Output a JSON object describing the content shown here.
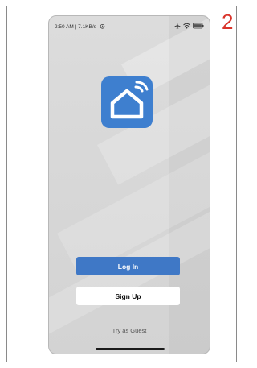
{
  "figure": {
    "step_number": "2"
  },
  "status_bar": {
    "time_speed": "2:50 AM | 7.1KB/s",
    "icons": [
      "alarm-icon",
      "airplane-icon",
      "wifi-icon",
      "battery-icon"
    ]
  },
  "app": {
    "icon": "smart-home-icon",
    "brand_color": "#3e7fcf"
  },
  "buttons": {
    "login_label": "Log In",
    "signup_label": "Sign Up"
  },
  "guest": {
    "label": "Try as Guest"
  },
  "colors": {
    "step_number": "#d9342b",
    "login_button": "#3f78c6",
    "signup_button": "#ffffff"
  }
}
